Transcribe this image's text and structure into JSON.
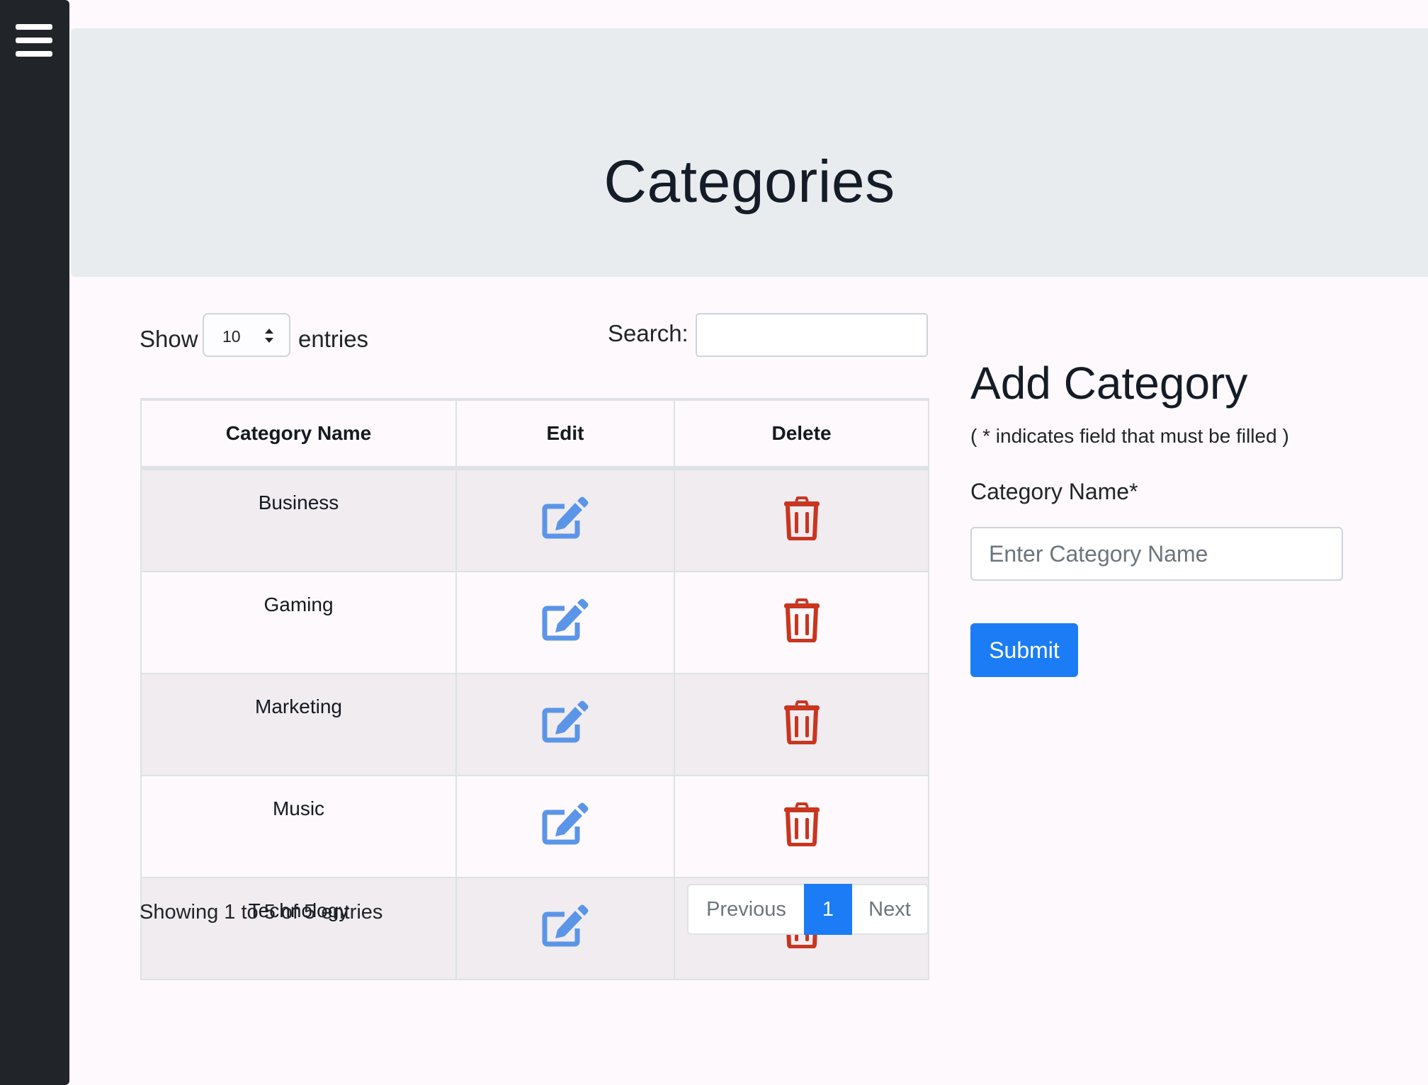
{
  "page": {
    "title": "Categories"
  },
  "table_controls": {
    "show_label": "Show",
    "length_value": "10",
    "entries_label": "entries",
    "search_label": "Search:",
    "search_value": ""
  },
  "table": {
    "columns": [
      "Category Name",
      "Edit",
      "Delete"
    ],
    "rows": [
      {
        "name": "Business"
      },
      {
        "name": "Gaming"
      },
      {
        "name": "Marketing"
      },
      {
        "name": "Music"
      },
      {
        "name": "Technology"
      }
    ],
    "edit_icon": "edit-icon",
    "delete_icon": "trash-icon"
  },
  "footer": {
    "info": "Showing 1 to 5 of 5 entries",
    "previous_label": "Previous",
    "current_page": "1",
    "next_label": "Next"
  },
  "form": {
    "title": "Add Category",
    "note": "( * indicates field that must be filled )",
    "field_label": "Category Name*",
    "field_placeholder": "Enter Category Name",
    "field_value": "",
    "submit_label": "Submit"
  },
  "colors": {
    "sidebar": "#212429",
    "header_bg": "#e9ecef",
    "primary": "#1b7cf5",
    "edit_icon": "#5b95e8",
    "delete_icon": "#c9351f"
  }
}
